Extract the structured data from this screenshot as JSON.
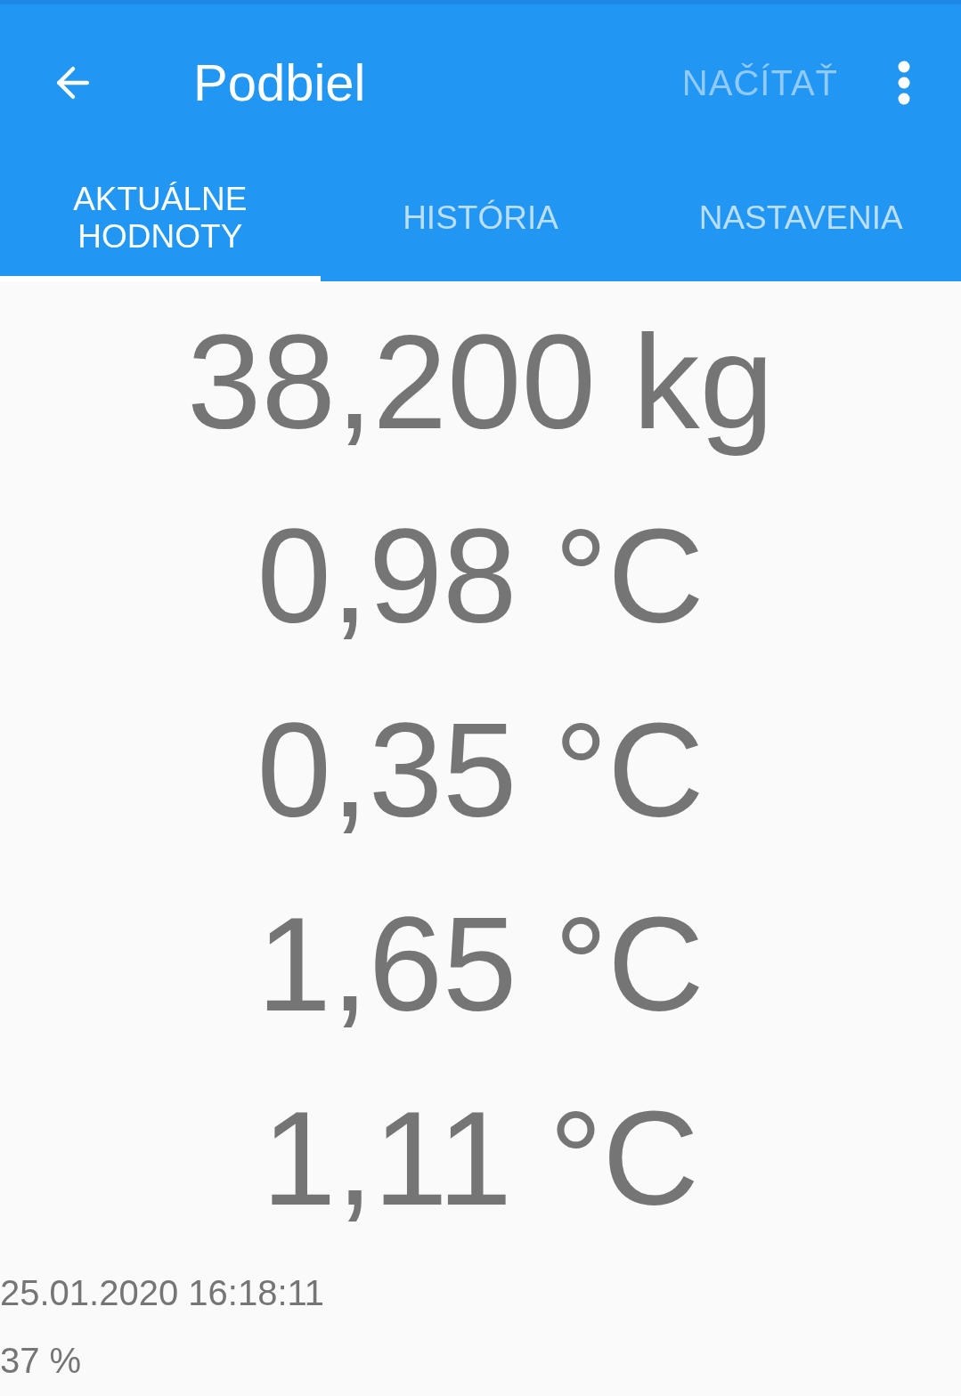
{
  "app_bar": {
    "title": "Podbiel",
    "action": {
      "label": "NAČÍTAŤ",
      "disabled": true
    }
  },
  "tabs": [
    {
      "label": "AKTUÁLNE HODNOTY",
      "selected": true
    },
    {
      "label": "HISTÓRIA",
      "selected": false
    },
    {
      "label": "NASTAVENIA",
      "selected": false
    }
  ],
  "readings": [
    "38,200 kg",
    "0,98 °C",
    "0,35 °C",
    "1,65 °C",
    "1,11 °C"
  ],
  "timestamp": "25.01.2020 16:18:11",
  "battery": "37 %"
}
